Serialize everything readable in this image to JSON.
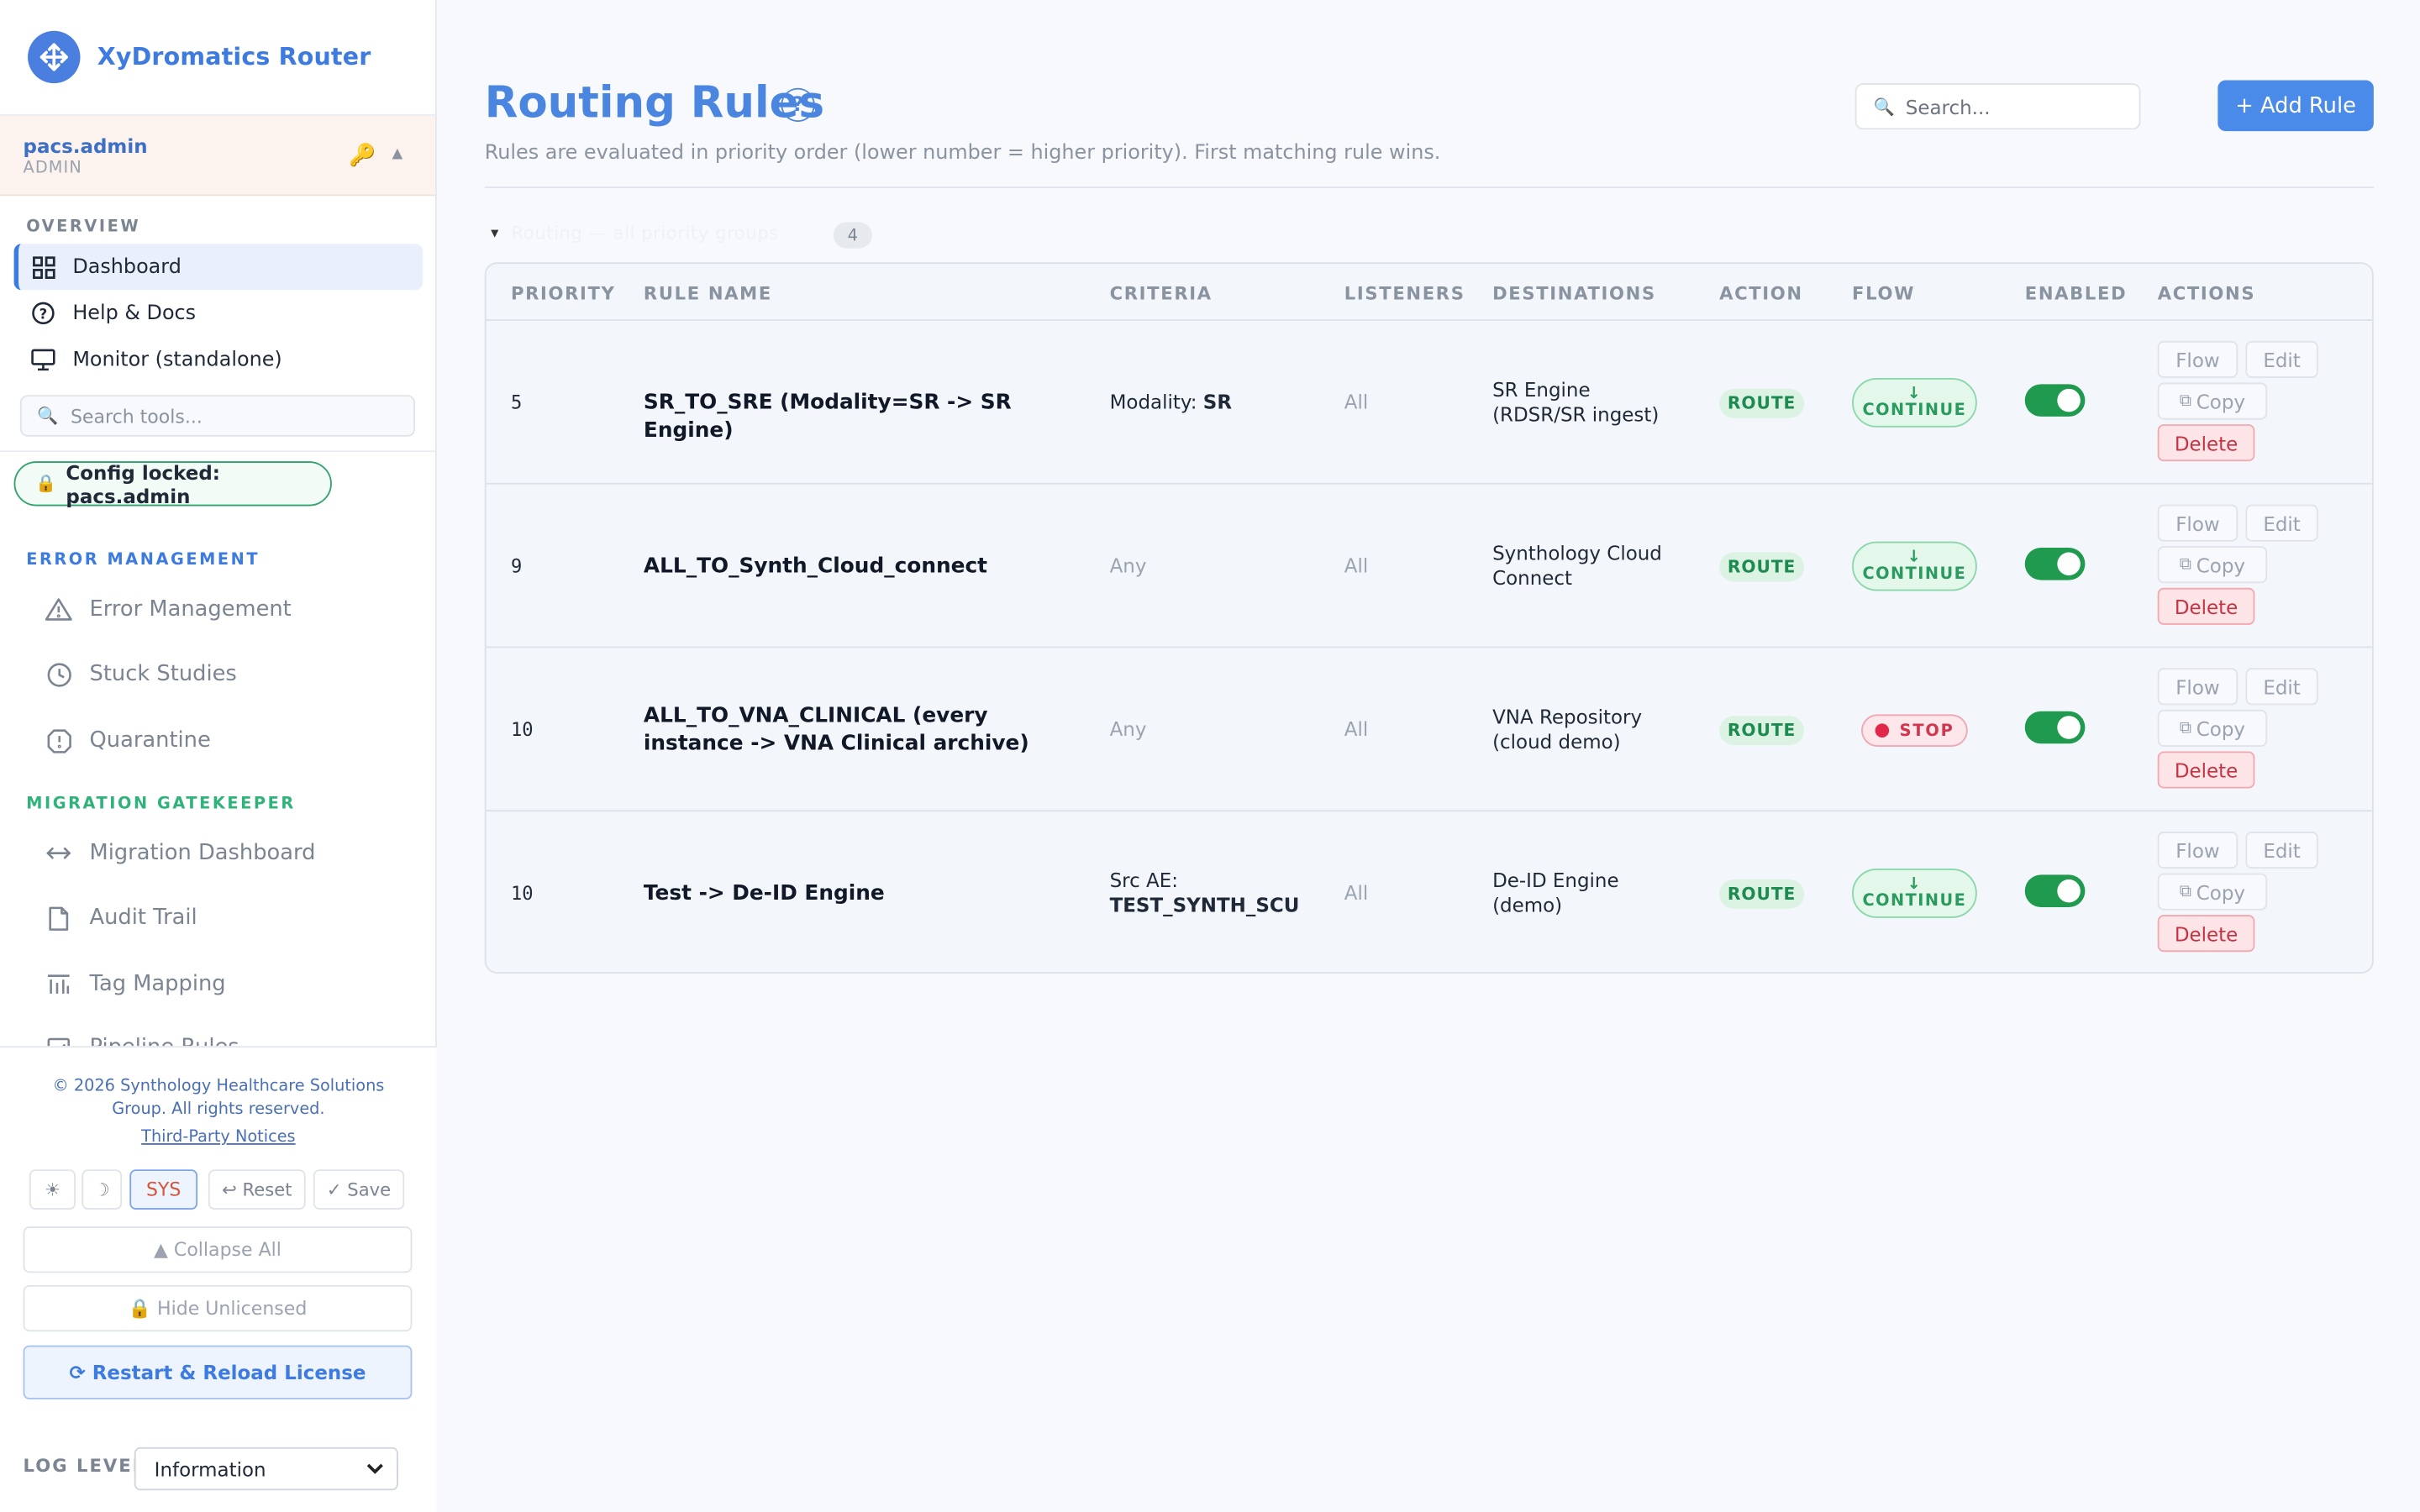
{
  "app": {
    "title": "XyDromatics Router"
  },
  "user": {
    "name": "pacs.admin",
    "role": "ADMIN"
  },
  "sidebar": {
    "overview_title": "OVERVIEW",
    "nav": [
      {
        "label": "Dashboard"
      },
      {
        "label": "Help & Docs"
      },
      {
        "label": "Monitor (standalone)"
      }
    ],
    "search_placeholder": "Search tools...",
    "config_lock": "Config locked: pacs.admin",
    "error_section": "ERROR MANAGEMENT",
    "error_items": [
      {
        "label": "Error Management"
      },
      {
        "label": "Stuck Studies"
      },
      {
        "label": "Quarantine"
      }
    ],
    "migration_section": "MIGRATION GATEKEEPER",
    "migration_items": [
      {
        "label": "Migration Dashboard"
      },
      {
        "label": "Audit Trail"
      },
      {
        "label": "Tag Mapping"
      },
      {
        "label": "Pipeline Rules"
      }
    ],
    "colors": {
      "accent": "#3d7be0",
      "error_section": "#3d7be0",
      "migration_section": "#2fb37a"
    }
  },
  "footer": {
    "copyright": "© 2026 Synthology Healthcare Solutions Group. All rights reserved.",
    "third_party": "Third-Party Notices",
    "theme_light": "☀",
    "theme_dark": "☽",
    "theme_sys": "SYS",
    "reset": "↩ Reset",
    "save": "✓ Save",
    "collapse_all": "▲ Collapse All",
    "hide_unlicensed": "🔒 Hide Unlicensed",
    "restart": "⟳ Restart & Reload License",
    "log_level_label": "LOG LEVEL",
    "log_level_value": "Information"
  },
  "main": {
    "title": "Routing Rules",
    "subtitle": "Rules are evaluated in priority order (lower number = higher priority). First matching rule wins.",
    "search_placeholder": "Search...",
    "add_rule": "+ Add Rule",
    "group_label": "Routing — all priority groups",
    "group_count": "4",
    "columns": [
      "PRIORITY",
      "RULE NAME",
      "CRITERIA",
      "LISTENERS",
      "DESTINATIONS",
      "ACTION",
      "FLOW",
      "ENABLED",
      "ACTIONS"
    ],
    "action_buttons": {
      "flow": "Flow",
      "edit": "Edit",
      "copy": "Copy",
      "delete": "Delete"
    },
    "rows": [
      {
        "priority": "5",
        "name": "SR_TO_SRE (Modality=SR -> SR Engine)",
        "criteria_label": "Modality: ",
        "criteria_value": "SR",
        "listeners": "All",
        "destinations": "SR Engine (RDSR/SR ingest)",
        "action": "ROUTE",
        "flow": "CONTINUE",
        "flow_arrow": "↓",
        "enabled": true
      },
      {
        "priority": "9",
        "name": "ALL_TO_Synth_Cloud_connect",
        "criteria_label": "Any",
        "criteria_value": "",
        "listeners": "All",
        "destinations": "Synthology Cloud Connect",
        "action": "ROUTE",
        "flow": "CONTINUE",
        "flow_arrow": "↓",
        "enabled": true
      },
      {
        "priority": "10",
        "name": "ALL_TO_VNA_CLINICAL (every instance -> VNA Clinical archive)",
        "criteria_label": "Any",
        "criteria_value": "",
        "listeners": "All",
        "destinations": "VNA Repository (cloud demo)",
        "action": "ROUTE",
        "flow": "STOP",
        "flow_arrow": "",
        "enabled": true
      },
      {
        "priority": "10",
        "name": "Test -> De-ID Engine",
        "criteria_label": "Src AE:",
        "criteria_value": "TEST_SYNTH_SCU",
        "listeners": "All",
        "destinations": "De-ID Engine (demo)",
        "action": "ROUTE",
        "flow": "CONTINUE",
        "flow_arrow": "↓",
        "enabled": true
      }
    ]
  }
}
